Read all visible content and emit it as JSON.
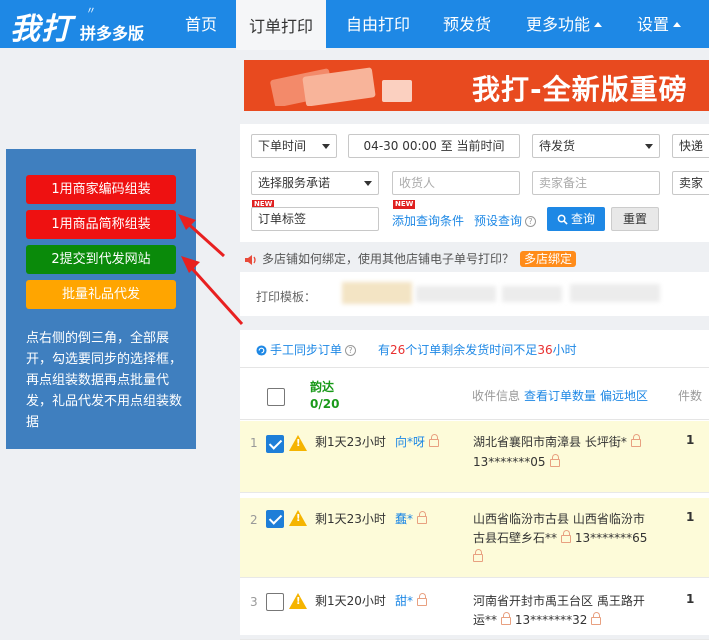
{
  "app": {
    "logo": "我打",
    "logo_sub": "拼多多版"
  },
  "nav": [
    {
      "label": "首页"
    },
    {
      "label": "订单打印"
    },
    {
      "label": "自由打印"
    },
    {
      "label": "预发货"
    },
    {
      "label": "更多功能"
    },
    {
      "label": "设置"
    }
  ],
  "left_panel": {
    "buttons": [
      {
        "label": "1用商家编码组装",
        "color": "#ee1111"
      },
      {
        "label": "1用商品简称组装",
        "color": "#ee1111"
      },
      {
        "label": "2提交到代发网站",
        "color": "#0a8a0a"
      },
      {
        "label": "批量礼品代发",
        "color": "#ffa500"
      }
    ],
    "instructions": "点右侧的倒三角，全部展开，勾选要同步的选择框，再点组装数据再点批量代发，礼品代发不用点组装数据"
  },
  "banner": {
    "text": "我打-全新版重磅"
  },
  "filters": {
    "time_type": "下单时间",
    "date_range": "04-30 00:00 至 当前时间",
    "status": "待发货",
    "express": "快递",
    "service": "选择服务承诺",
    "recipient_placeholder": "收货人",
    "seller_note_placeholder": "卖家备注",
    "buyer_note_placeholder": "卖家",
    "order_tag": "订单标签",
    "new_badge": "NEW",
    "add_condition": "添加查询条件",
    "preset_query": "预设查询",
    "query_button": "查询",
    "reset_button": "重置"
  },
  "notice": {
    "text": "多店铺如何绑定，使用其他店铺电子单号打印？",
    "tag": "多店绑定"
  },
  "print_template": {
    "label": "打印模板："
  },
  "order_bar": {
    "sync_label": "手工同步订单",
    "prefix": "有",
    "count": "26",
    "middle": "个订单剩余发货时间不足",
    "hours": "36",
    "suffix": "小时"
  },
  "table": {
    "header": {
      "express_name": "韵达",
      "express_count": "0/20",
      "recipient_info": "收件信息",
      "view_count": "查看订单数量",
      "remote_area": "偏远地区",
      "quantity": "件数"
    },
    "rows": [
      {
        "index": "1",
        "checked": true,
        "remaining": "剩1天23小时",
        "buyer": "向*呀",
        "address_line1": "湖北省襄阳市南漳县 长坪街*",
        "address_line2": "13*******05",
        "address_line3": "",
        "qty": "1"
      },
      {
        "index": "2",
        "checked": true,
        "remaining": "剩1天23小时",
        "buyer": "蠢*",
        "address_line1": "山西省临汾市古县 山西省临汾市",
        "address_line2": "古县石壁乡石**",
        "address_line2b": "13*******65",
        "address_line3": "",
        "qty": "1"
      },
      {
        "index": "3",
        "checked": false,
        "remaining": "剩1天20小时",
        "buyer": "甜*",
        "address_line1": "河南省开封市禹王台区 禹王路开",
        "address_line2": "运**",
        "address_line2b": "13*******32",
        "address_line3": "",
        "qty": "1"
      }
    ]
  }
}
